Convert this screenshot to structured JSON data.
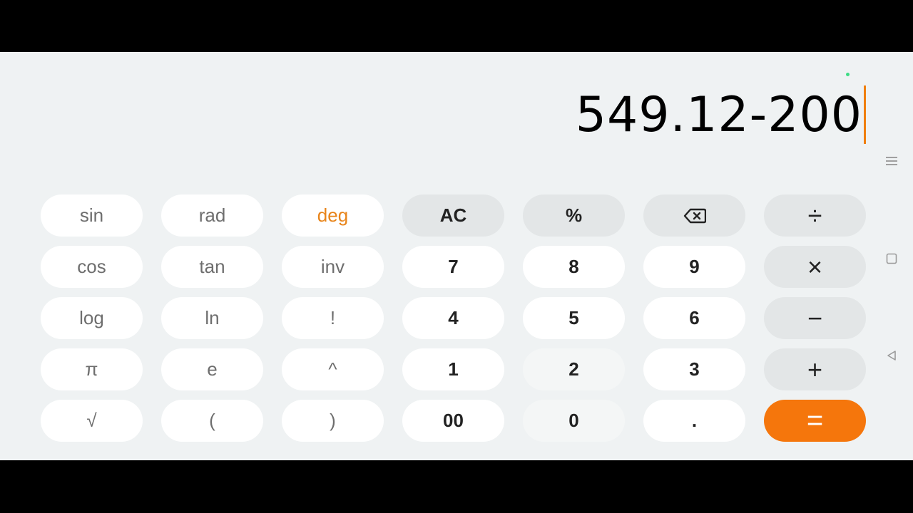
{
  "display": {
    "expression": "549.12-200"
  },
  "colors": {
    "accent": "#f5760c",
    "cursor": "#f07f0f",
    "background": "#eff2f3"
  },
  "keypad": {
    "rows": [
      [
        {
          "label": "sin",
          "name": "sin-button"
        },
        {
          "label": "rad",
          "name": "rad-button"
        },
        {
          "label": "deg",
          "name": "deg-button"
        },
        {
          "label": "AC",
          "name": "all-clear-button"
        },
        {
          "label": "%",
          "name": "percent-button"
        },
        {
          "label": "",
          "name": "backspace-button",
          "icon": "backspace-icon"
        },
        {
          "label": "÷",
          "name": "divide-button"
        }
      ],
      [
        {
          "label": "cos",
          "name": "cos-button"
        },
        {
          "label": "tan",
          "name": "tan-button"
        },
        {
          "label": "inv",
          "name": "inv-button"
        },
        {
          "label": "7",
          "name": "digit-7-button"
        },
        {
          "label": "8",
          "name": "digit-8-button"
        },
        {
          "label": "9",
          "name": "digit-9-button"
        },
        {
          "label": "×",
          "name": "multiply-button"
        }
      ],
      [
        {
          "label": "log",
          "name": "log-button"
        },
        {
          "label": "ln",
          "name": "ln-button"
        },
        {
          "label": "!",
          "name": "factorial-button"
        },
        {
          "label": "4",
          "name": "digit-4-button"
        },
        {
          "label": "5",
          "name": "digit-5-button"
        },
        {
          "label": "6",
          "name": "digit-6-button"
        },
        {
          "label": "−",
          "name": "subtract-button"
        }
      ],
      [
        {
          "label": "π",
          "name": "pi-button"
        },
        {
          "label": "e",
          "name": "euler-button"
        },
        {
          "label": "^",
          "name": "power-button"
        },
        {
          "label": "1",
          "name": "digit-1-button"
        },
        {
          "label": "2",
          "name": "digit-2-button"
        },
        {
          "label": "3",
          "name": "digit-3-button"
        },
        {
          "label": "+",
          "name": "add-button"
        }
      ],
      [
        {
          "label": "√",
          "name": "sqrt-button"
        },
        {
          "label": "(",
          "name": "open-paren-button"
        },
        {
          "label": ")",
          "name": "close-paren-button"
        },
        {
          "label": "00",
          "name": "double-zero-button"
        },
        {
          "label": "0",
          "name": "digit-0-button"
        },
        {
          "label": ".",
          "name": "decimal-point-button"
        },
        {
          "label": "=",
          "name": "equals-button"
        }
      ]
    ]
  },
  "navigation": {
    "menu_icon": "menu-icon",
    "recent_apps_icon": "square-icon",
    "back_icon": "triangle-back-icon"
  }
}
